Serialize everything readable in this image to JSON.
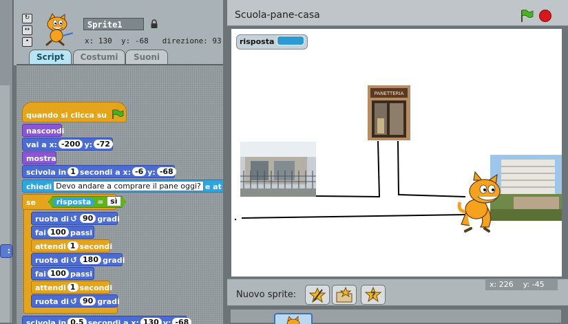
{
  "sprite": {
    "name": "Sprite1",
    "coords": "x: 130  y: -68   direzione: 93"
  },
  "tabs": {
    "script": "Script",
    "costumes": "Costumi",
    "sounds": "Suoni"
  },
  "palette_fragment": ":",
  "script": {
    "hat": "quando si clicca su",
    "hide": "nascondi",
    "goto": {
      "label": "vai a x:",
      "x": "-200",
      "y_label": "y:",
      "y": "-72"
    },
    "show": "mostra",
    "glide1": {
      "label": "scivola in",
      "secs": "1",
      "mid": "secondi a x:",
      "x": "-6",
      "y_label": "y:",
      "y": "-68"
    },
    "ask": {
      "label": "chiedi",
      "question": "Devo andare a comprare il pane oggi?",
      "tail": "e at"
    },
    "if": {
      "label": "se",
      "var": "risposta",
      "op": "=",
      "value": "sì"
    },
    "turn1": {
      "label": "ruota di",
      "deg": "90",
      "unit": "gradi"
    },
    "move1": {
      "label": "fai",
      "steps": "100",
      "unit": "passi"
    },
    "wait1": {
      "label": "attendi",
      "secs": "1",
      "unit": "secondi"
    },
    "turn2": {
      "label": "ruota di",
      "deg": "180",
      "unit": "gradi"
    },
    "move2": {
      "label": "fai",
      "steps": "100",
      "unit": "passi"
    },
    "wait2": {
      "label": "attendi",
      "secs": "1",
      "unit": "secondi"
    },
    "turn3": {
      "label": "ruota di",
      "deg": "90",
      "unit": "gradi"
    },
    "glide2": {
      "label": "scivola in",
      "secs": "0.5",
      "mid": "secondi a x:",
      "x": "130",
      "y_label": "y:",
      "y": "-68"
    }
  },
  "stage": {
    "title": "Scuola-pane-casa",
    "variable_monitor": {
      "name": "risposta"
    },
    "bakery_sign": "PANETTERIA"
  },
  "new_sprite": {
    "label": "Nuovo sprite:"
  },
  "mouse": {
    "readout": "x: 226    y: -45"
  },
  "colors": {
    "motion": "#4a6cd4",
    "looks": "#8a55d7",
    "control": "#e4a41c",
    "sensing": "#2ca5e2",
    "operators": "#5cb712",
    "variables": "#ee7d16"
  },
  "icons": [
    "rotate-icon",
    "center-icon",
    "fix-icon",
    "lock-icon",
    "green-flag-icon",
    "stop-icon",
    "paint-sprite-icon",
    "import-sprite-icon",
    "random-sprite-icon",
    "turn-left-icon"
  ]
}
